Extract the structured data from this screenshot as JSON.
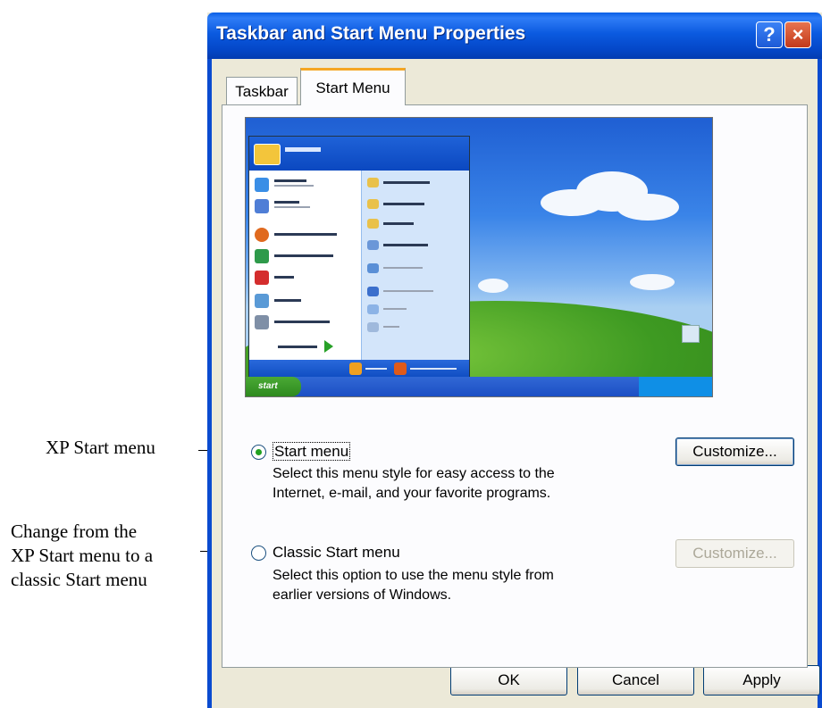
{
  "callouts": {
    "xp_start": "XP Start menu",
    "classic": [
      "Change from the",
      "XP Start menu to a",
      "classic Start menu"
    ]
  },
  "window": {
    "title": "Taskbar and Start Menu Properties",
    "help_glyph": "?",
    "close_glyph": "×"
  },
  "tabs": [
    {
      "label": "Taskbar",
      "selected": false
    },
    {
      "label": "Start Menu",
      "selected": true
    }
  ],
  "preview": {
    "start_label": "start"
  },
  "options": {
    "start_menu": {
      "label": "Start menu",
      "selected": true,
      "description": [
        "Select this menu style for easy access to the",
        "Internet, e-mail, and your favorite programs."
      ],
      "customize_label": "Customize..."
    },
    "classic_menu": {
      "label": "Classic Start menu",
      "selected": false,
      "description": [
        "Select this option to use the menu style from",
        "earlier versions of Windows."
      ],
      "customize_label": "Customize..."
    }
  },
  "buttons": {
    "ok": "OK",
    "cancel": "Cancel",
    "apply": "Apply"
  },
  "colors": {
    "titlebar": "#0a5fe6",
    "dialog_face": "#ece9d8",
    "tab_highlight": "#f5a623",
    "radio_dot": "#21a121"
  }
}
